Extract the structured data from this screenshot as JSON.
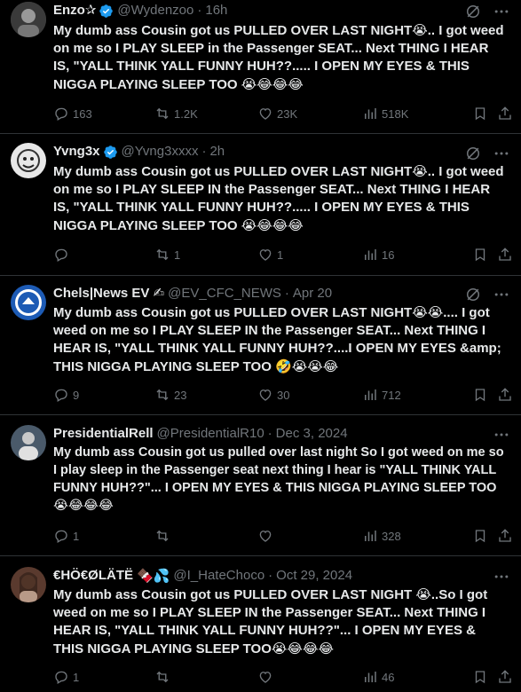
{
  "tweets": [
    {
      "name": "Enzo✰",
      "verified": true,
      "handle": "@Wydenzoo",
      "sep": "·",
      "time": "16h",
      "text": "My dumb ass Cousin got us PULLED OVER LAST NIGHT",
      "text2": ".. I got weed on me so I PLAY SLEEP in the Passenger SEAT... Next THING I HEAR IS, \"YALL THINK YALL FUNNY HUH??..... I OPEN MY EYES & THIS NIGGA PLAYING SLEEP TOO ",
      "emojis_a": "😭",
      "emojis_b": "😭😂😂😂",
      "replies": "163",
      "reposts": "1.2K",
      "likes": "23K",
      "views": "518K",
      "avatar_color": "#555555"
    },
    {
      "name": "Yvng3x",
      "verified": true,
      "handle": "@Yvng3xxxx",
      "sep": "·",
      "time": "2h",
      "text": "My dumb ass Cousin got us PULLED OVER LAST NIGHT",
      "text2": ".. I got weed on me so I PLAY SLEEP IN the Passenger SEAT... Next THING I HEAR IS, \"YALL THINK YALL FUNNY HUH??..... I OPEN MY EYES & THIS NIGGA PLAYING SLEEP TOO ",
      "emojis_a": "😭",
      "emojis_b": "😭😂😂😂",
      "replies": "",
      "reposts": "1",
      "likes": "1",
      "views": "16",
      "avatar_color": "#d8d8d8"
    },
    {
      "name": "Chels|News EV ✍",
      "verified": false,
      "handle": "@EV_CFC_NEWS",
      "sep": "·",
      "time": "Apr 20",
      "text": "My dumb ass Cousin got us PULLED OVER LAST NIGHT",
      "text2": ".... I got weed on me so I PLAY SLEEP IN the Passenger SEAT... Next THING I HEAR IS, \"YALL THINK YALL FUNNY HUH??....I OPEN MY EYES &amp; THIS NIGGA PLAYING SLEEP TOO ",
      "emojis_a": "😭😭",
      "emojis_b": "🤣😭😭😂",
      "replies": "9",
      "reposts": "23",
      "likes": "30",
      "views": "712",
      "avatar_color": "#1d5bb5"
    },
    {
      "name": "PresidentialRell",
      "verified": false,
      "handle": "@PresidentialR10",
      "sep": "·",
      "time": "Dec 3, 2024",
      "text": "My dumb ass Cousin got us pulled over last night So I got weed on me so I play sleep in the Passenger seat next thing I hear is  \"YALL THINK YALL FUNNY HUH??\"... I OPEN MY EYES & THIS NIGGA PLAYING SLEEP TOO",
      "text2": "",
      "emojis_a": "",
      "emojis_b": "😭😂😂😂",
      "replies": "1",
      "reposts": "",
      "likes": "",
      "views": "328",
      "avatar_color": "#7a8fa0"
    },
    {
      "name": "€HÖ€ØLÄTË",
      "name_emoji": "🍫💦",
      "verified": false,
      "handle": "@I_HateChoco",
      "sep": "·",
      "time": "Oct 29, 2024",
      "text": "My dumb ass Cousin got us PULLED OVER LAST NIGHT ",
      "text2": "..So I got weed on me so I PLAY SLEEP IN the Passenger SEAT... Next THING I HEAR IS,  \"YALL THINK YALL FUNNY HUH??\"... I OPEN MY EYES & THIS NIGGA PLAYING SLEEP TOO",
      "emojis_a": "😭",
      "emojis_b": "😭😂😂😂",
      "replies": "1",
      "reposts": "",
      "likes": "",
      "views": "46",
      "avatar_color": "#6b4a3a"
    }
  ]
}
